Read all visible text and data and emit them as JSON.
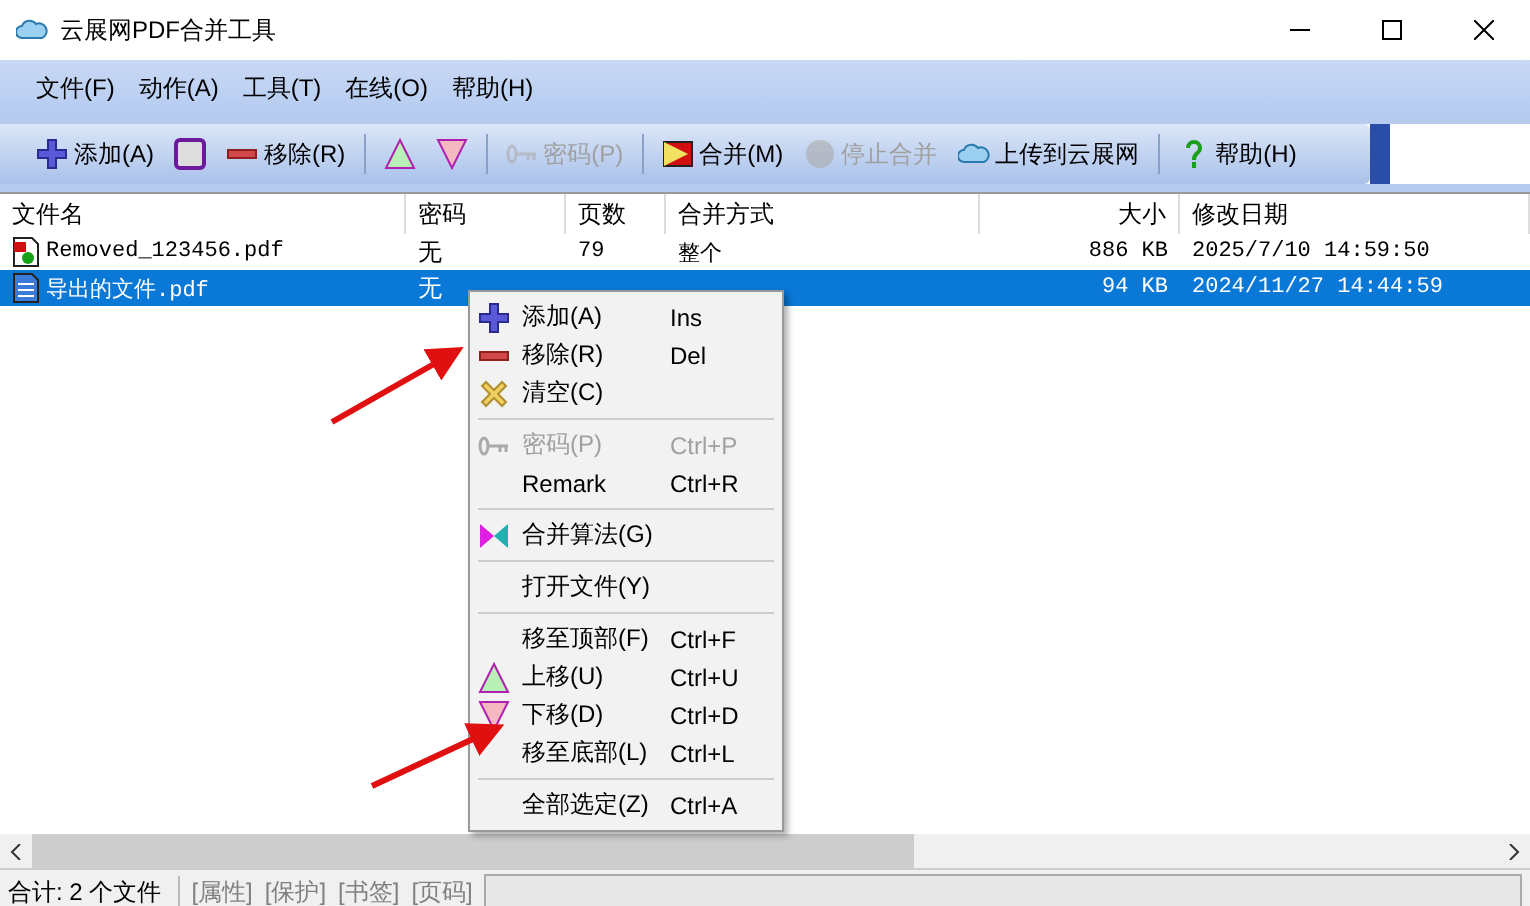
{
  "window": {
    "title": "云展网PDF合并工具"
  },
  "menu_bar": [
    "文件(F)",
    "动作(A)",
    "工具(T)",
    "在线(O)",
    "帮助(H)"
  ],
  "toolbar": [
    {
      "kind": "button",
      "label": "添加(A)",
      "disabled": false
    },
    {
      "kind": "button",
      "disabled": false
    },
    {
      "kind": "button",
      "label": "移除(R)",
      "disabled": false
    },
    {
      "kind": "separator"
    },
    {
      "kind": "button",
      "disabled": false
    },
    {
      "kind": "button",
      "disabled": false
    },
    {
      "kind": "separator"
    },
    {
      "kind": "button",
      "label": "密码(P)",
      "disabled": true
    },
    {
      "kind": "separator"
    },
    {
      "kind": "button",
      "label": "合并(M)",
      "disabled": false
    },
    {
      "kind": "button",
      "label": "停止合并",
      "disabled": true
    },
    {
      "kind": "button",
      "label": "上传到云展网",
      "disabled": false
    },
    {
      "kind": "separator"
    },
    {
      "kind": "button",
      "label": "帮助(H)",
      "disabled": false
    }
  ],
  "table": {
    "columns": [
      "文件名",
      "密码",
      "页数",
      "合并方式",
      "大小",
      "修改日期"
    ],
    "rows": [
      {
        "selected": false,
        "name": "Removed_123456.pdf",
        "password": "无",
        "pages": "79",
        "merge_mode": "整个",
        "size": "886 KB",
        "modified": "2025/7/10 14:59:50"
      },
      {
        "selected": true,
        "name": "导出的文件.pdf",
        "password": "无",
        "size": "94 KB",
        "modified": "2024/11/27 14:44:59"
      }
    ]
  },
  "context_menu": [
    {
      "kind": "item",
      "label": "添加(A)",
      "shortcut": "Ins",
      "disabled": false
    },
    {
      "kind": "item",
      "label": "移除(R)",
      "shortcut": "Del",
      "disabled": false
    },
    {
      "kind": "item",
      "label": "清空(C)",
      "disabled": false
    },
    {
      "kind": "separator"
    },
    {
      "kind": "item",
      "label": "密码(P)",
      "shortcut": "Ctrl+P",
      "disabled": true
    },
    {
      "kind": "item",
      "label": "Remark",
      "shortcut": "Ctrl+R",
      "disabled": false
    },
    {
      "kind": "separator"
    },
    {
      "kind": "item",
      "label": "合并算法(G)",
      "disabled": false
    },
    {
      "kind": "separator"
    },
    {
      "kind": "item",
      "label": "打开文件(Y)",
      "disabled": false
    },
    {
      "kind": "separator"
    },
    {
      "kind": "item",
      "label": "移至顶部(F)",
      "shortcut": "Ctrl+F",
      "disabled": false
    },
    {
      "kind": "item",
      "label": "上移(U)",
      "shortcut": "Ctrl+U",
      "disabled": false
    },
    {
      "kind": "item",
      "label": "下移(D)",
      "shortcut": "Ctrl+D",
      "disabled": false
    },
    {
      "kind": "item",
      "label": "移至底部(L)",
      "shortcut": "Ctrl+L",
      "disabled": false
    },
    {
      "kind": "separator"
    },
    {
      "kind": "item",
      "label": "全部选定(Z)",
      "shortcut": "Ctrl+A",
      "disabled": false
    }
  ],
  "status_bar": {
    "summary": "合计: 2 个文件",
    "tags": [
      "[属性]",
      "[保护]",
      "[书签]",
      "[页码]"
    ]
  }
}
